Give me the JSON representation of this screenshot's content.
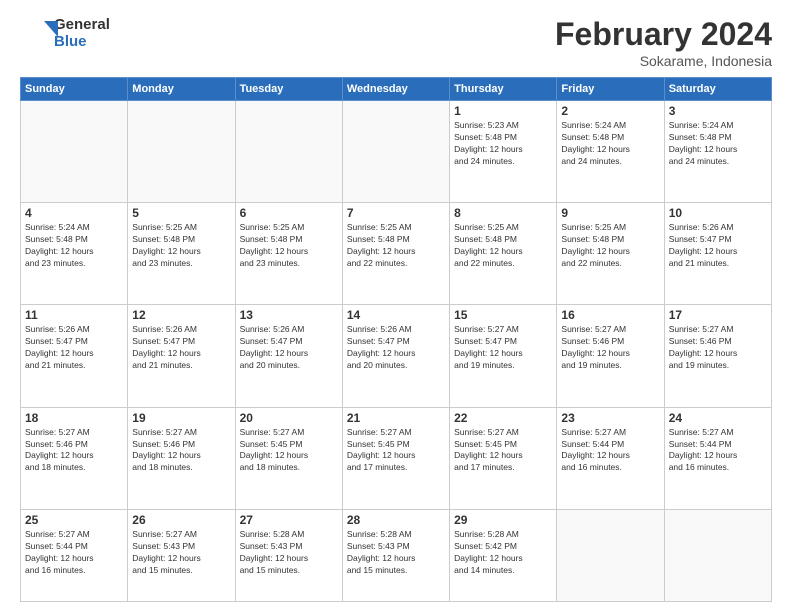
{
  "logo": {
    "line1": "General",
    "line2": "Blue"
  },
  "title": "February 2024",
  "subtitle": "Sokarame, Indonesia",
  "weekdays": [
    "Sunday",
    "Monday",
    "Tuesday",
    "Wednesday",
    "Thursday",
    "Friday",
    "Saturday"
  ],
  "weeks": [
    [
      {
        "day": "",
        "info": ""
      },
      {
        "day": "",
        "info": ""
      },
      {
        "day": "",
        "info": ""
      },
      {
        "day": "",
        "info": ""
      },
      {
        "day": "1",
        "info": "Sunrise: 5:23 AM\nSunset: 5:48 PM\nDaylight: 12 hours\nand 24 minutes."
      },
      {
        "day": "2",
        "info": "Sunrise: 5:24 AM\nSunset: 5:48 PM\nDaylight: 12 hours\nand 24 minutes."
      },
      {
        "day": "3",
        "info": "Sunrise: 5:24 AM\nSunset: 5:48 PM\nDaylight: 12 hours\nand 24 minutes."
      }
    ],
    [
      {
        "day": "4",
        "info": "Sunrise: 5:24 AM\nSunset: 5:48 PM\nDaylight: 12 hours\nand 23 minutes."
      },
      {
        "day": "5",
        "info": "Sunrise: 5:25 AM\nSunset: 5:48 PM\nDaylight: 12 hours\nand 23 minutes."
      },
      {
        "day": "6",
        "info": "Sunrise: 5:25 AM\nSunset: 5:48 PM\nDaylight: 12 hours\nand 23 minutes."
      },
      {
        "day": "7",
        "info": "Sunrise: 5:25 AM\nSunset: 5:48 PM\nDaylight: 12 hours\nand 22 minutes."
      },
      {
        "day": "8",
        "info": "Sunrise: 5:25 AM\nSunset: 5:48 PM\nDaylight: 12 hours\nand 22 minutes."
      },
      {
        "day": "9",
        "info": "Sunrise: 5:25 AM\nSunset: 5:48 PM\nDaylight: 12 hours\nand 22 minutes."
      },
      {
        "day": "10",
        "info": "Sunrise: 5:26 AM\nSunset: 5:47 PM\nDaylight: 12 hours\nand 21 minutes."
      }
    ],
    [
      {
        "day": "11",
        "info": "Sunrise: 5:26 AM\nSunset: 5:47 PM\nDaylight: 12 hours\nand 21 minutes."
      },
      {
        "day": "12",
        "info": "Sunrise: 5:26 AM\nSunset: 5:47 PM\nDaylight: 12 hours\nand 21 minutes."
      },
      {
        "day": "13",
        "info": "Sunrise: 5:26 AM\nSunset: 5:47 PM\nDaylight: 12 hours\nand 20 minutes."
      },
      {
        "day": "14",
        "info": "Sunrise: 5:26 AM\nSunset: 5:47 PM\nDaylight: 12 hours\nand 20 minutes."
      },
      {
        "day": "15",
        "info": "Sunrise: 5:27 AM\nSunset: 5:47 PM\nDaylight: 12 hours\nand 19 minutes."
      },
      {
        "day": "16",
        "info": "Sunrise: 5:27 AM\nSunset: 5:46 PM\nDaylight: 12 hours\nand 19 minutes."
      },
      {
        "day": "17",
        "info": "Sunrise: 5:27 AM\nSunset: 5:46 PM\nDaylight: 12 hours\nand 19 minutes."
      }
    ],
    [
      {
        "day": "18",
        "info": "Sunrise: 5:27 AM\nSunset: 5:46 PM\nDaylight: 12 hours\nand 18 minutes."
      },
      {
        "day": "19",
        "info": "Sunrise: 5:27 AM\nSunset: 5:46 PM\nDaylight: 12 hours\nand 18 minutes."
      },
      {
        "day": "20",
        "info": "Sunrise: 5:27 AM\nSunset: 5:45 PM\nDaylight: 12 hours\nand 18 minutes."
      },
      {
        "day": "21",
        "info": "Sunrise: 5:27 AM\nSunset: 5:45 PM\nDaylight: 12 hours\nand 17 minutes."
      },
      {
        "day": "22",
        "info": "Sunrise: 5:27 AM\nSunset: 5:45 PM\nDaylight: 12 hours\nand 17 minutes."
      },
      {
        "day": "23",
        "info": "Sunrise: 5:27 AM\nSunset: 5:44 PM\nDaylight: 12 hours\nand 16 minutes."
      },
      {
        "day": "24",
        "info": "Sunrise: 5:27 AM\nSunset: 5:44 PM\nDaylight: 12 hours\nand 16 minutes."
      }
    ],
    [
      {
        "day": "25",
        "info": "Sunrise: 5:27 AM\nSunset: 5:44 PM\nDaylight: 12 hours\nand 16 minutes."
      },
      {
        "day": "26",
        "info": "Sunrise: 5:27 AM\nSunset: 5:43 PM\nDaylight: 12 hours\nand 15 minutes."
      },
      {
        "day": "27",
        "info": "Sunrise: 5:28 AM\nSunset: 5:43 PM\nDaylight: 12 hours\nand 15 minutes."
      },
      {
        "day": "28",
        "info": "Sunrise: 5:28 AM\nSunset: 5:43 PM\nDaylight: 12 hours\nand 15 minutes."
      },
      {
        "day": "29",
        "info": "Sunrise: 5:28 AM\nSunset: 5:42 PM\nDaylight: 12 hours\nand 14 minutes."
      },
      {
        "day": "",
        "info": ""
      },
      {
        "day": "",
        "info": ""
      }
    ]
  ]
}
